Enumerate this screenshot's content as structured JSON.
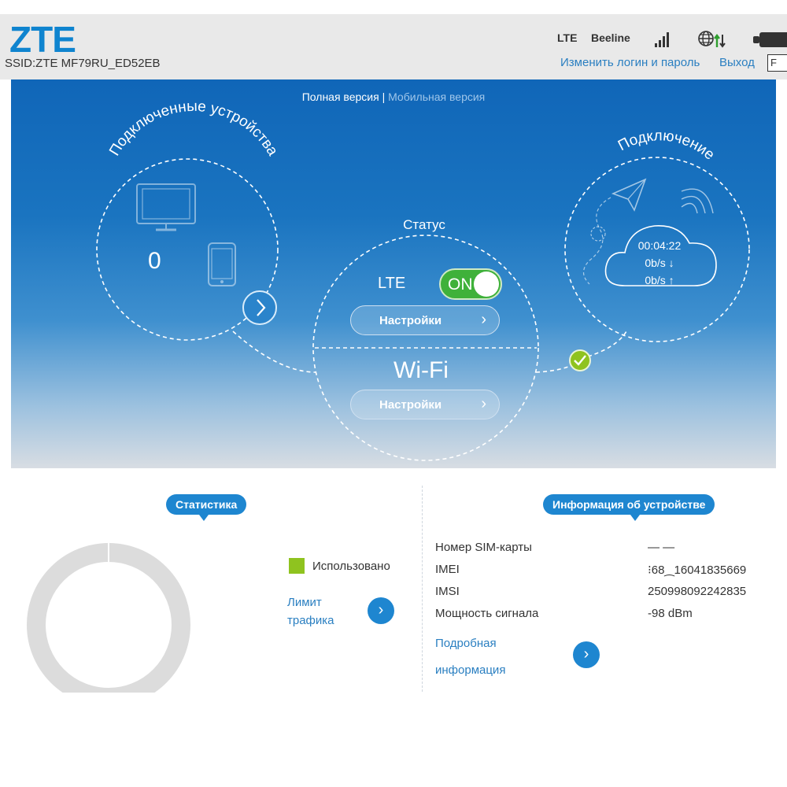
{
  "header": {
    "logo": "ZTE",
    "ssid": "SSID:ZTE MF79RU_ED52EB",
    "network_type": "LTE",
    "operator": "Beeline",
    "change_login": "Изменить логин и пароль",
    "logout": "Выход",
    "language_box": "F",
    "icons": [
      "signal-bars-icon",
      "globe-icon",
      "data-arrows-icon",
      "battery-icon"
    ]
  },
  "hero": {
    "version_full": "Полная версия",
    "version_separator": "|",
    "version_mobile": "Мобильная версия",
    "devices": {
      "title": "Подключенные устройства",
      "count": "0",
      "more": "›"
    },
    "status": {
      "title": "Статус",
      "lte_label": "LTE",
      "lte_toggle": "ON",
      "lte_settings": "Настройки",
      "wifi_label": "Wi-Fi",
      "wifi_settings": "Настройки",
      "chevron": "›"
    },
    "connection": {
      "title": "Подключение",
      "time": "00:04:22",
      "download": "0b/s ↓",
      "upload": "0b/s ↑"
    }
  },
  "statistics": {
    "title": "Статистика",
    "legend_used": "Использовано",
    "traffic_limit": "Лимит трафика",
    "used_fraction": 0,
    "colors": {
      "used": "#8fc31f",
      "ring": "#dcdcdc"
    }
  },
  "device_info": {
    "title": "Информация об устройстве",
    "rows": [
      {
        "key": "Номер SIM-карты",
        "value": "— —"
      },
      {
        "key": "IMEI",
        "value": "⁝68⁔16041835669"
      },
      {
        "key": "IMSI",
        "value": "250998092242835"
      },
      {
        "key": "Мощность сигнала",
        "value": "-98 dBm"
      }
    ],
    "details_link": "Подробная информация",
    "details_btn": "›"
  },
  "colors": {
    "accent": "#1e86d0",
    "link": "#2a7fc1",
    "toggle_on": "#3fb13a",
    "check": "#8fc31f"
  }
}
